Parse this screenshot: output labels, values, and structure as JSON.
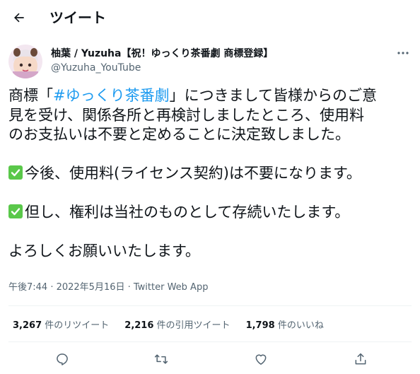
{
  "header": {
    "title": "ツイート",
    "back_icon": "arrow-left-icon"
  },
  "author": {
    "name": "柚葉 / Yuzuha【祝！ゆっくり茶番劇 商標登録】",
    "handle": "@Yuzuha_YouTube",
    "avatar_icon": "avatar-illustration"
  },
  "tweet": {
    "line1_pre": "商標「",
    "hashtag": "#ゆっくり茶番劇",
    "line1_post": "」につきまして皆様からのご意",
    "line2": "見を受け、関係各所と再検討しましたところ、使用料",
    "line3": "のお支払いは不要と定めることに決定致しました。",
    "point1": "今後、使用料(ライセンス契約)は不要になります。",
    "point2": "但し、権利は当社のものとして存続いたします。",
    "closing": "よろしくお願いいたします。"
  },
  "meta": "午後7:44 · 2022年5月16日 · Twitter Web App",
  "stats": {
    "retweets_count": "3,267",
    "retweets_label": "件のリツイート",
    "quotes_count": "2,216",
    "quotes_label": "件の引用ツイート",
    "likes_count": "1,798",
    "likes_label": "件のいいね"
  },
  "colors": {
    "accent": "#1d9bf0",
    "text": "#0f1419",
    "muted": "#536471",
    "check": "#5ac84a"
  }
}
